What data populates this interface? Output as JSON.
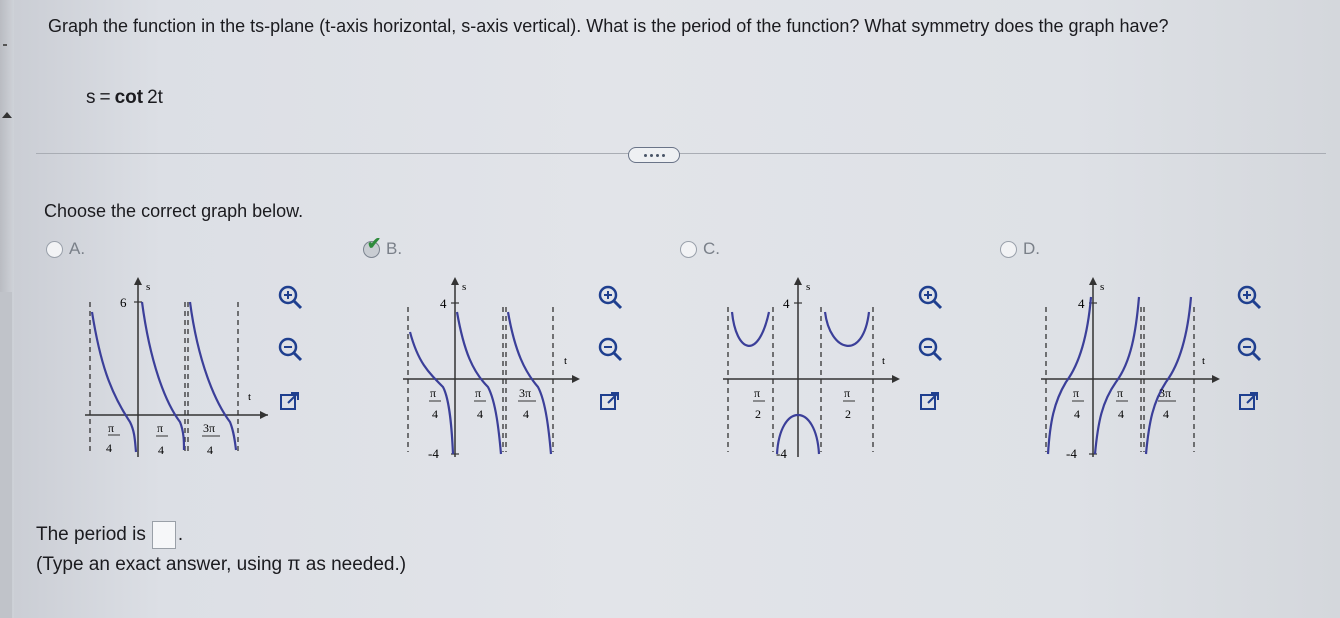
{
  "question": {
    "text": "Graph the function in the ts-plane (t-axis horizontal, s-axis vertical). What is the period of the function? What symmetry does the graph have?",
    "formula_lhs": "s",
    "formula_eq": "=",
    "formula_fn": "cot",
    "formula_arg": "2t"
  },
  "prompt": "Choose the correct graph below.",
  "options": [
    {
      "letter": "A.",
      "selected": false
    },
    {
      "letter": "B.",
      "selected": true
    },
    {
      "letter": "C.",
      "selected": false
    },
    {
      "letter": "D.",
      "selected": false
    }
  ],
  "graphs": {
    "A": {
      "s_tick": "6",
      "s_label": "s",
      "t_label": "t",
      "x_ticks": [
        {
          "num": "π",
          "den": "4",
          "neg": true
        },
        {
          "num": "π",
          "den": "4"
        },
        {
          "num": "3π",
          "den": "4"
        }
      ]
    },
    "B": {
      "s_tick_top": "4",
      "s_tick_bottom": "-4",
      "s_label": "s",
      "t_label": "t",
      "x_ticks": [
        {
          "num": "π",
          "den": "4",
          "neg": true
        },
        {
          "num": "π",
          "den": "4"
        },
        {
          "num": "3π",
          "den": "4"
        }
      ]
    },
    "C": {
      "s_tick_top": "4",
      "s_tick_bottom": "-4",
      "s_label": "s",
      "t_label": "t",
      "x_ticks": [
        {
          "num": "π",
          "den": "2",
          "neg": true
        },
        {
          "num": "π",
          "den": "2"
        }
      ]
    },
    "D": {
      "s_tick_top": "4",
      "s_tick_bottom": "-4",
      "s_label": "s",
      "t_label": "t",
      "x_ticks": [
        {
          "num": "π",
          "den": "4",
          "neg": true
        },
        {
          "num": "π",
          "den": "4"
        },
        {
          "num": "3π",
          "den": "4"
        }
      ]
    }
  },
  "tools": {
    "zoom_in": "zoom-in-icon",
    "zoom_out": "zoom-out-icon",
    "popout": "open-new-window-icon"
  },
  "period": {
    "label": "The period is",
    "end": ".",
    "hint": "(Type an exact answer, using π as needed.)"
  },
  "colors": {
    "curve": "#3b3f99",
    "accent_check": "#2e8b3c",
    "tool_icon": "#1f3f8f"
  }
}
